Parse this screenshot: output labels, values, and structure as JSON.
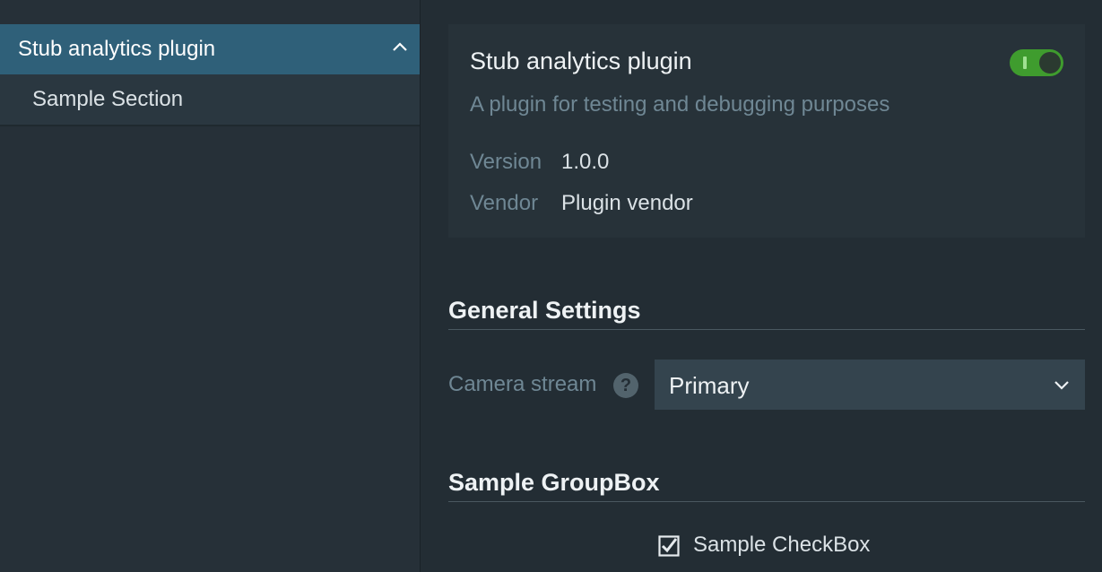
{
  "sidebar": {
    "group": {
      "label": "Stub analytics plugin",
      "expanded": true
    },
    "items": [
      {
        "label": "Sample Section"
      }
    ]
  },
  "plugin": {
    "title": "Stub analytics plugin",
    "description": "A plugin for testing and debugging purposes",
    "enabled": true,
    "version_label": "Version",
    "version": "1.0.0",
    "vendor_label": "Vendor",
    "vendor": "Plugin vendor"
  },
  "general_settings": {
    "title": "General Settings",
    "camera_stream": {
      "label": "Camera stream",
      "help_icon": "question-mark-icon",
      "value": "Primary"
    }
  },
  "group_box": {
    "title": "Sample GroupBox",
    "checkbox": {
      "label": "Sample CheckBox",
      "checked": true
    }
  },
  "colors": {
    "accent": "#2f6079",
    "toggle_on": "#3f9c2e",
    "background": "#232d34"
  }
}
